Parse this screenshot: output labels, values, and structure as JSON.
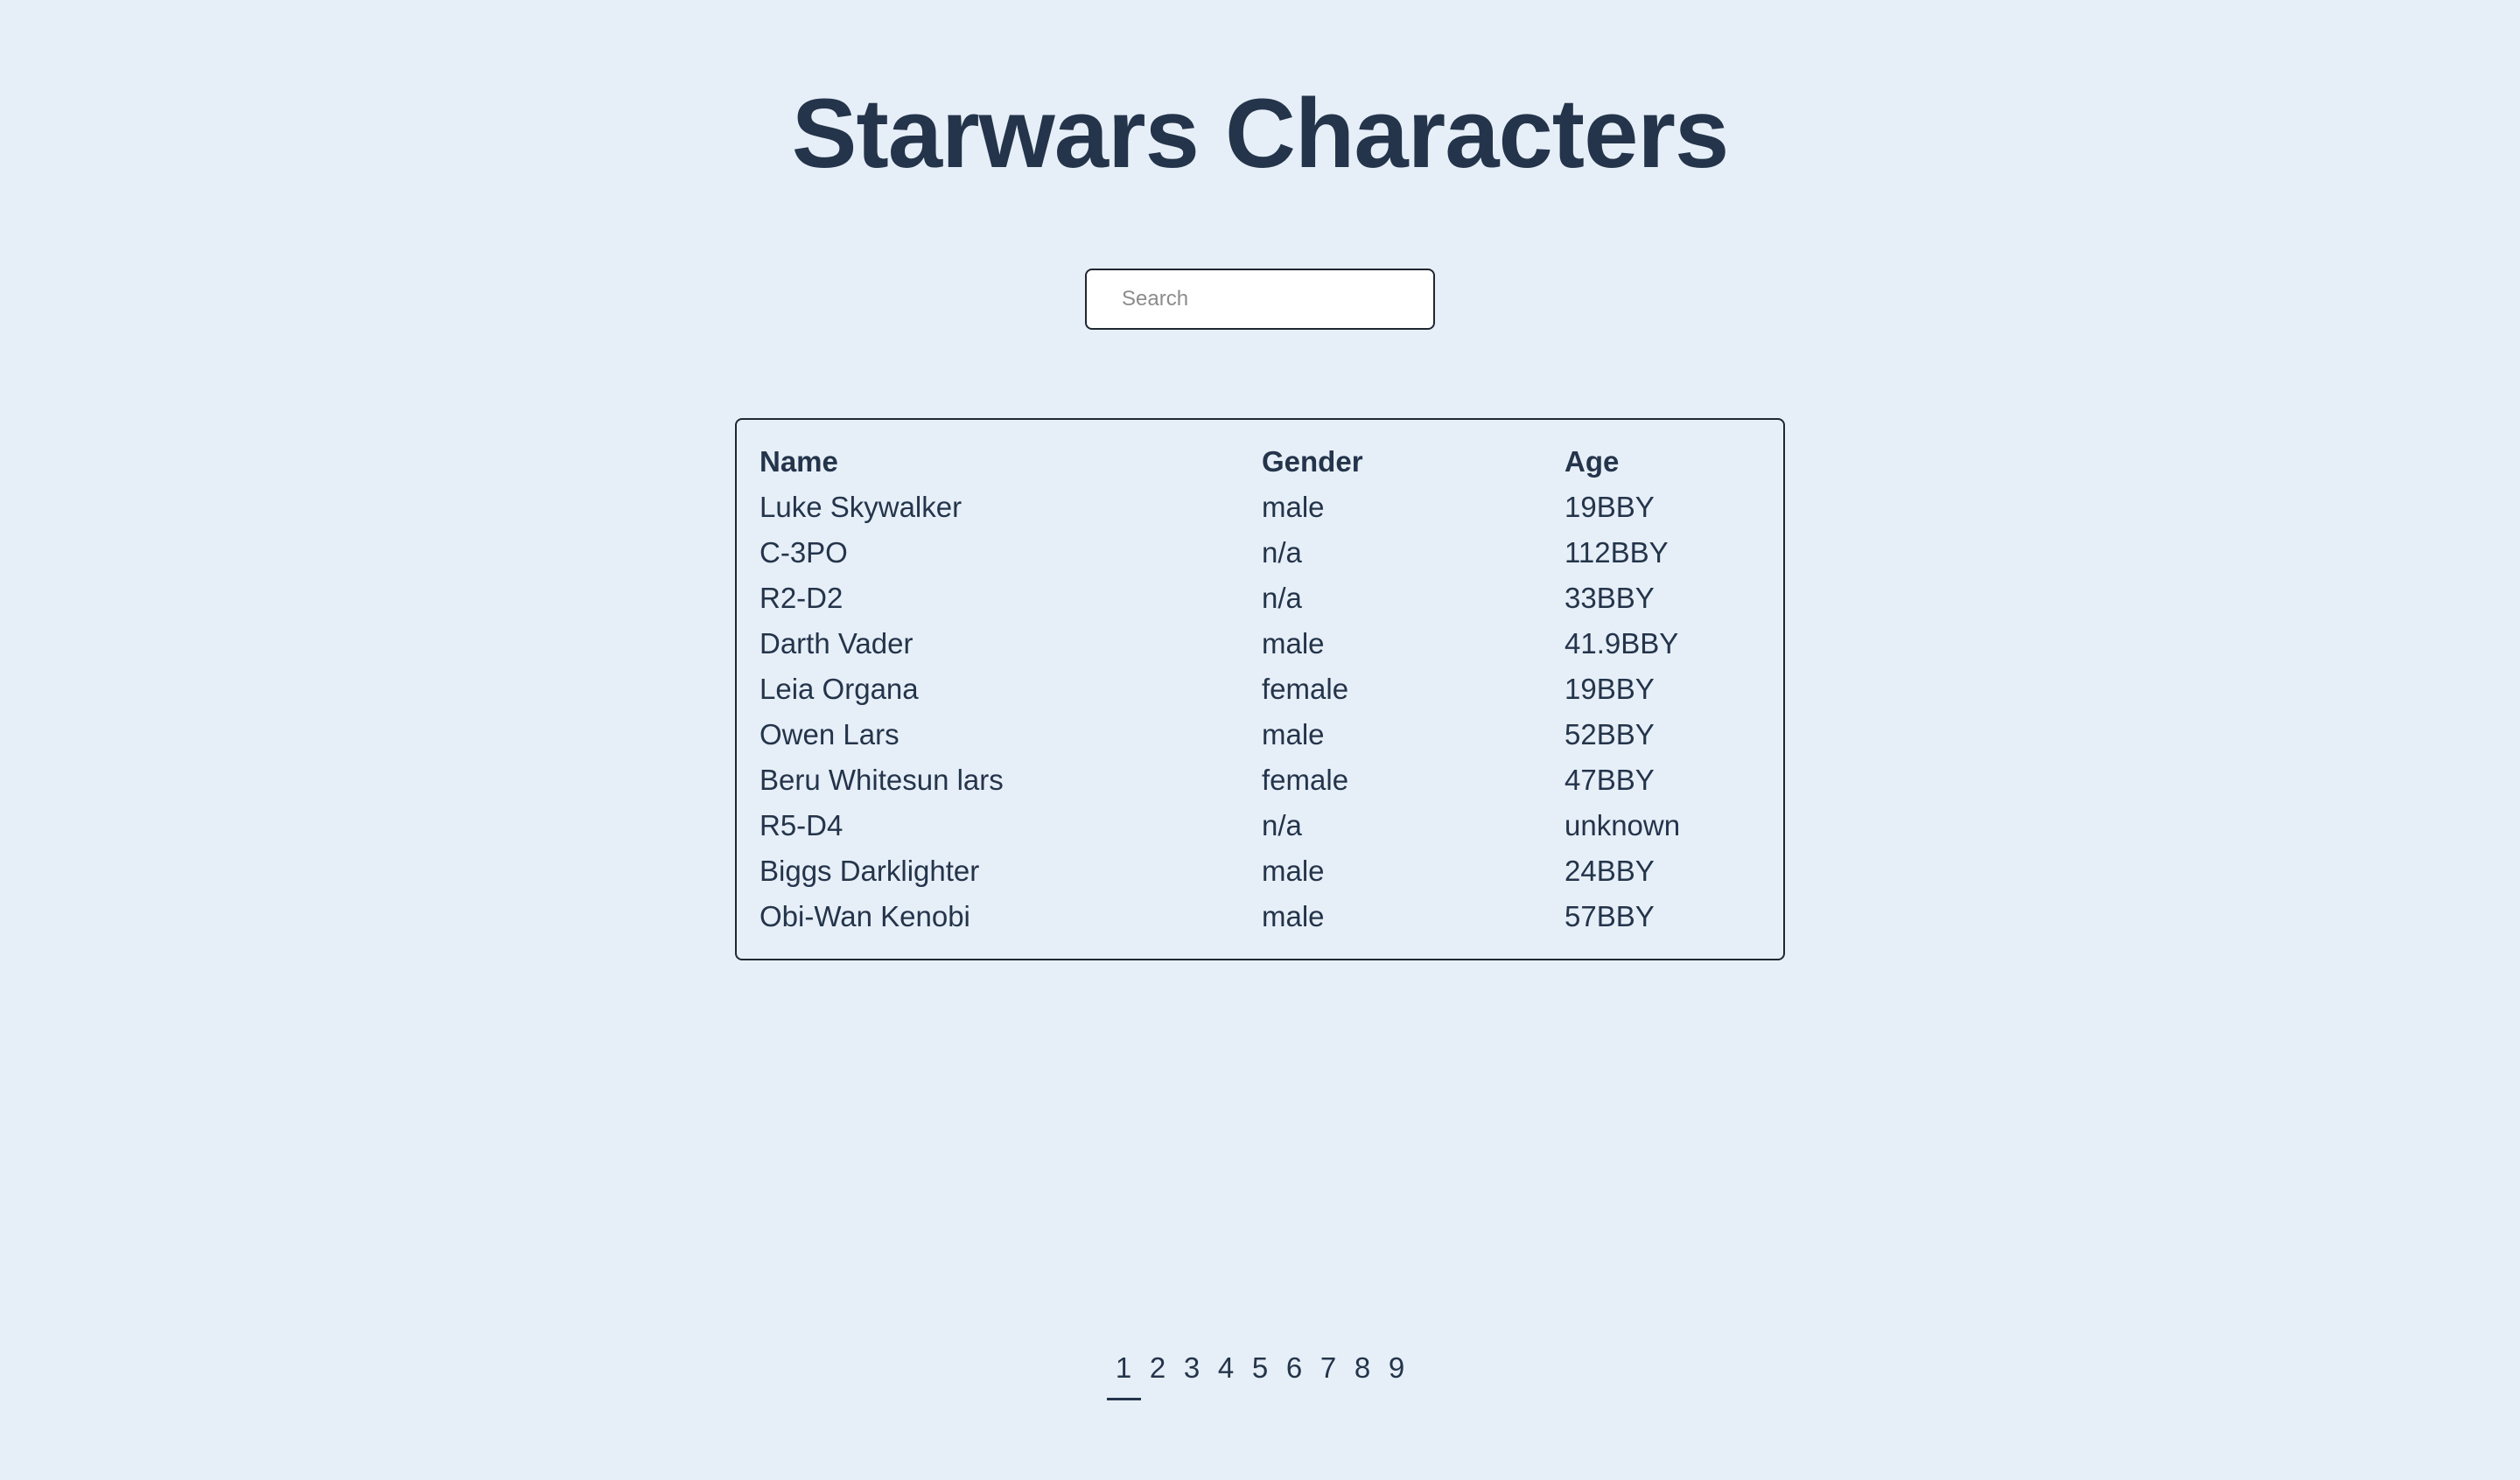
{
  "page": {
    "title": "Starwars Characters"
  },
  "search": {
    "placeholder": "Search",
    "value": ""
  },
  "table": {
    "headers": {
      "name": "Name",
      "gender": "Gender",
      "age": "Age"
    },
    "rows": [
      {
        "name": "Luke Skywalker",
        "gender": "male",
        "age": "19BBY"
      },
      {
        "name": "C-3PO",
        "gender": "n/a",
        "age": "112BBY"
      },
      {
        "name": "R2-D2",
        "gender": "n/a",
        "age": "33BBY"
      },
      {
        "name": "Darth Vader",
        "gender": "male",
        "age": "41.9BBY"
      },
      {
        "name": "Leia Organa",
        "gender": "female",
        "age": "19BBY"
      },
      {
        "name": "Owen Lars",
        "gender": "male",
        "age": "52BBY"
      },
      {
        "name": "Beru Whitesun lars",
        "gender": "female",
        "age": "47BBY"
      },
      {
        "name": "R5-D4",
        "gender": "n/a",
        "age": "unknown"
      },
      {
        "name": "Biggs Darklighter",
        "gender": "male",
        "age": "24BBY"
      },
      {
        "name": "Obi-Wan Kenobi",
        "gender": "male",
        "age": "57BBY"
      }
    ]
  },
  "pagination": {
    "pages": [
      "1",
      "2",
      "3",
      "4",
      "5",
      "6",
      "7",
      "8",
      "9"
    ],
    "current": "1"
  },
  "colors": {
    "background": "#e6eef7",
    "text": "#24344a",
    "border": "#1f2733"
  }
}
